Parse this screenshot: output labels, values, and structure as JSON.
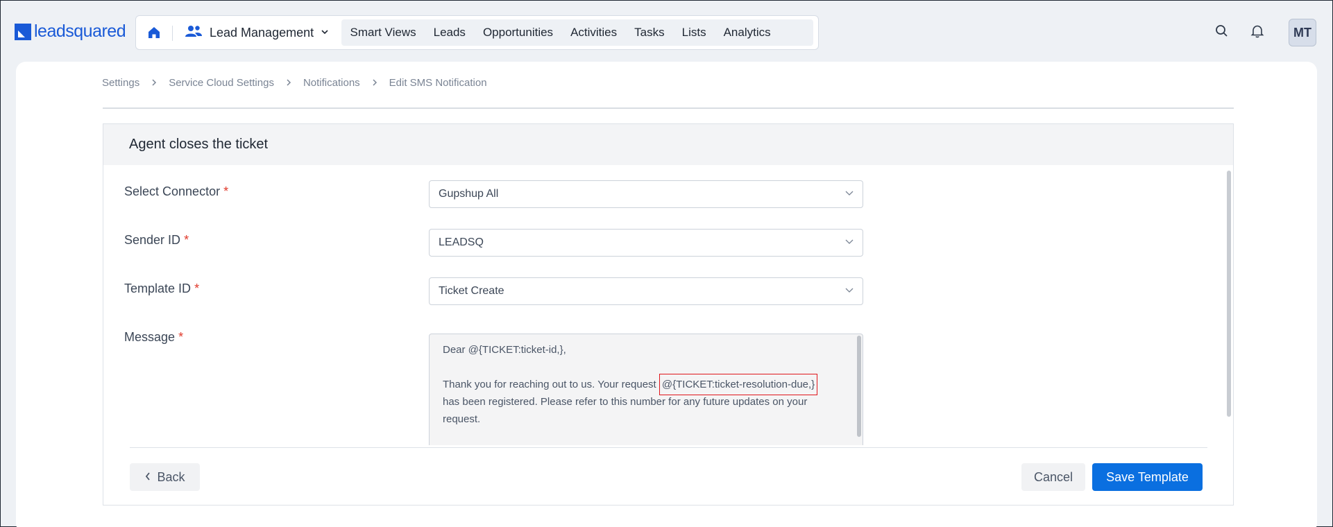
{
  "brand": {
    "logo_text": "leadsquared",
    "accent": "#1a5ad7",
    "primary_button": "#0a6fe0"
  },
  "nav": {
    "home_icon": "home-icon",
    "module": {
      "label": "Lead Management",
      "icon": "users-icon"
    },
    "menu": [
      "Smart Views",
      "Leads",
      "Opportunities",
      "Activities",
      "Tasks",
      "Lists",
      "Analytics"
    ]
  },
  "header_actions": {
    "search_icon": "search-icon",
    "bell_icon": "bell-icon",
    "avatar_initials": "MT"
  },
  "breadcrumb": [
    "Settings",
    "Service Cloud Settings",
    "Notifications",
    "Edit SMS Notification"
  ],
  "panel": {
    "title": "Agent closes the ticket"
  },
  "form": {
    "connector": {
      "label": "Select Connector",
      "value": "Gupshup All"
    },
    "sender": {
      "label": "Sender ID",
      "value": "LEADSQ"
    },
    "template": {
      "label": "Template ID",
      "value": "Ticket Create"
    },
    "message": {
      "label": "Message",
      "line1": "Dear @{TICKET:ticket-id,},",
      "line2_prefix": "Thank you for reaching out to us. Your request ",
      "line2_highlight": "@{TICKET:ticket-resolution-due,}",
      "line3": "has been registered. Please refer to this number for any future updates on your",
      "line4": "request."
    },
    "required_marker": "*"
  },
  "footer": {
    "back_label": "Back",
    "cancel_label": "Cancel",
    "save_label": "Save Template"
  }
}
